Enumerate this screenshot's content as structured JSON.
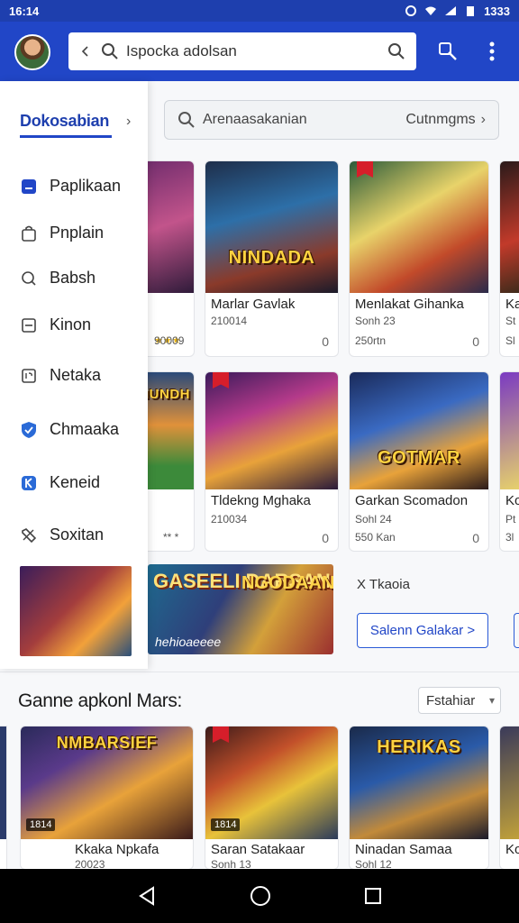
{
  "status_bar": {
    "time": "16:14",
    "battery": "1333"
  },
  "app_bar": {
    "search_value": "Ispocka adolsan",
    "icons": [
      "back-icon",
      "search-icon",
      "search-icon",
      "cart-icon",
      "more-vert-icon"
    ]
  },
  "drawer": {
    "title": "Dokosabian",
    "items": [
      {
        "label": "Paplikaan",
        "icon": "app-icon"
      },
      {
        "label": "Pnplain",
        "icon": "bag-icon"
      },
      {
        "label": "Babsh",
        "icon": "search-icon"
      },
      {
        "label": "Kinon",
        "icon": "square-icon"
      },
      {
        "label": "Netaka",
        "icon": "image-icon"
      },
      {
        "label": "Chmaaka",
        "icon": "shield-icon"
      },
      {
        "label": "Keneid",
        "icon": "k-badge-icon"
      },
      {
        "label": "Soxitan",
        "icon": "tag-icon"
      }
    ]
  },
  "main_search": {
    "placeholder": "Arenaasakanian",
    "category": "Cutnmgms"
  },
  "grid_row1": [
    {
      "title": "",
      "sub": "",
      "sub2": "90009"
    },
    {
      "title": "Marlar Gavlak",
      "art_title": "NINDADA",
      "sub": "210014",
      "meta": "0"
    },
    {
      "title": "Menlakat Gihanka",
      "sub": "Sonh 23",
      "sub2": "250rtn",
      "meta": "0"
    },
    {
      "title": "Ka",
      "sub": "St",
      "sub2": "Sl"
    }
  ],
  "grid_row2": [
    {
      "title": "",
      "art_title": "JHUNDH",
      "sub": "",
      "sub2": "** *"
    },
    {
      "title": "Tldekng Mghaka",
      "sub": "210034",
      "meta": "0"
    },
    {
      "title": "Garkan Scomadon",
      "art_title": "GOTMAR",
      "sub": "Sohl 24",
      "sub2": "550 Kan",
      "meta": "0"
    },
    {
      "title": "Ko",
      "sub": "Pt",
      "sub2": "3l"
    }
  ],
  "banner": {
    "title_a": "GASEELI DARSAN",
    "title_b": "NGODAAN",
    "caption": "hehioaeeee"
  },
  "promo": {
    "label": "X Tkaoia",
    "button": "Salenn Galakar >"
  },
  "section": {
    "title": "Ganne apkonl Mars:",
    "filter": "Fstahiar"
  },
  "bottom_row": [
    {
      "title": "",
      "sub": ""
    },
    {
      "title": "Kkaka Npkafa",
      "art_title": "NMBARSIEF",
      "sub": "20023",
      "badge": "1814"
    },
    {
      "title": "Saran Satakaar",
      "sub": "Sonh 13",
      "badge": "1814"
    },
    {
      "title": "Ninadan Samaa",
      "art_title": "HERIKAS",
      "sub": "Sohl 12"
    },
    {
      "title": "Ko",
      "sub": ""
    }
  ],
  "colors": {
    "brand": "#2146c7",
    "status": "#1e3fae",
    "accent": "#2a5bd7"
  }
}
